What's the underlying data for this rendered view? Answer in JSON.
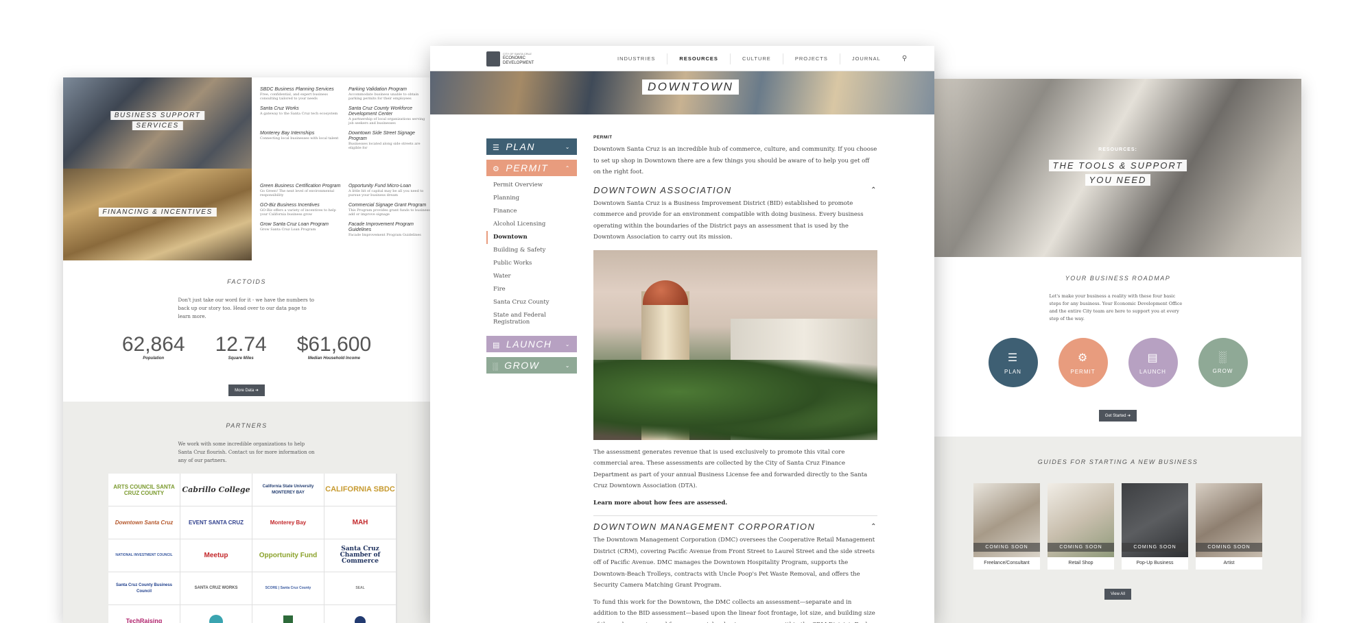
{
  "left": {
    "tile1_label_line1": "BUSINESS SUPPORT",
    "tile1_label_line2": "SERVICES",
    "tile2_label": "FINANCING & INCENTIVES",
    "links_group1": [
      {
        "title": "SBDC Business Planning Services",
        "desc": "Free, confidential, and expert business consulting tailored to your needs"
      },
      {
        "title": "Parking Validation Program",
        "desc": "Accommodate business unable to obtain parking permits for their employees"
      },
      {
        "title": "Santa Cruz Works",
        "desc": "A gateway to the Santa Cruz tech ecosystem"
      },
      {
        "title": "Santa Cruz County Workforce Development Center",
        "desc": "A partnership of local organizations serving job seekers and businesses"
      },
      {
        "title": "Monterey Bay Internships",
        "desc": "Connecting local businesses with local talent"
      },
      {
        "title": "Downtown Side Street Signage Program",
        "desc": "Businesses located along side streets are eligible for"
      }
    ],
    "links_group2": [
      {
        "title": "Green Business Certification Program",
        "desc": "Go Green! The next level of environmental responsibility"
      },
      {
        "title": "Opportunity Fund Micro-Loan",
        "desc": "A little bit of capital may be all you need to pursue your business dream"
      },
      {
        "title": "GO-Biz Business Incentives",
        "desc": "GO-Biz offers a variety of incentives to help your California business grow"
      },
      {
        "title": "Commercial Signage Grant Program",
        "desc": "This Program provides grant funds to business add or improve signage"
      },
      {
        "title": "Grow Santa Cruz Loan Program",
        "desc": "Grow Santa Cruz Loan Program"
      },
      {
        "title": "Facade Improvement Program Guidelines",
        "desc": "Facade Improvement Program Guidelines"
      }
    ],
    "factoids": {
      "title": "FACTOIDS",
      "desc": "Don't just take our word for it - we have the numbers to back up our story too. Head over to our data page to learn more.",
      "stats": [
        {
          "value": "62,864",
          "label": "Population"
        },
        {
          "value": "12.74",
          "label": "Square Miles"
        },
        {
          "value": "$61,600",
          "label": "Median Household Income"
        }
      ],
      "button": "More Data"
    },
    "partners": {
      "title": "PARTNERS",
      "desc": "We work with some incredible organizations to help Santa Cruz flourish. Contact us for more information on any of our partners.",
      "logos": [
        "ARTS COUNCIL SANTA CRUZ COUNTY",
        "Cabrillo College",
        "California State University MONTEREY BAY",
        "CALIFORNIA SBDC",
        "Downtown Santa Cruz",
        "EVENT SANTA CRUZ",
        "Monterey Bay",
        "MAH",
        "NATIONAL INVESTMENT COUNCIL",
        "Meetup",
        "Opportunity Fund",
        "Santa Cruz Chamber of Commerce",
        "Santa Cruz County Business Council",
        "SANTA CRUZ WORKS",
        "SCORE | Santa Cruz County",
        "SEAL",
        "TechRaising",
        "",
        "",
        ""
      ]
    }
  },
  "center": {
    "logo_small": "CITY OF SANTA CRUZ",
    "logo_line1": "ECONOMIC",
    "logo_line2": "DEVELOPMENT",
    "nav": [
      "INDUSTRIES",
      "RESOURCES",
      "CULTURE",
      "PROJECTS",
      "JOURNAL"
    ],
    "hero_title": "DOWNTOWN",
    "side_nav": {
      "plan": "PLAN",
      "permit": "PERMIT",
      "launch": "LAUNCH",
      "grow": "GROW",
      "permit_items": [
        "Permit Overview",
        "Planning",
        "Finance",
        "Alcohol Licensing",
        "Downtown",
        "Building & Safety",
        "Public Works",
        "Water",
        "Fire",
        "Santa Cruz County",
        "State and Federal Registration"
      ]
    },
    "content": {
      "kicker": "PERMIT",
      "intro": "Downtown Santa Cruz is an incredible hub of commerce, culture, and community. If you choose to set up shop in Downtown there are a few things you should be aware of to help you get off on the right foot.",
      "h2_assoc": "DOWNTOWN ASSOCIATION",
      "assoc_p": "Downtown Santa Cruz is a Business Improvement District (BID) established to promote commerce and provide for an environment compatible with doing business. Every business operating within the boundaries of the District pays an assessment that is used by the Downtown Association to carry out its mission.",
      "assoc_p2": "The assessment generates revenue that is used exclusively to promote this vital core commercial area. These assessments are collected by the City of Santa Cruz Finance Department as part of your annual Business License fee and forwarded directly to the Santa Cruz Downtown Association (DTA).",
      "learn_more": "Learn more about how fees are assessed.",
      "h2_dmc": "DOWNTOWN MANAGEMENT CORPORATION",
      "dmc_p": "The Downtown Management Corporation (DMC) oversees the Cooperative Retail Management District (CRM), covering Pacific Avenue from Front Street to Laurel Street and the side streets off of Pacific Avenue. DMC manages the Downtown Hospitality Program, supports the Downtown-Beach Trolleys, contracts with Uncle Poop's Pet Waste Removal, and offers the Security Camera Matching Grant Program.",
      "dmc_p2": "To fund this work for the Downtown, the DMC collects an assessment—separate and in addition to the BID assessment—based upon the linear foot frontage, lot size, and building size of the real property used for commercial or business purposes within the CRM District. Each parcel's assessment is calculated as following a three-part formula:"
    }
  },
  "right": {
    "kicker": "RESOURCES:",
    "hero_line1": "THE TOOLS & SUPPORT",
    "hero_line2": "YOU NEED",
    "roadmap": {
      "title": "YOUR BUSINESS ROADMAP",
      "desc": "Let's make your business a reality with these four basic steps for any business. Your Economic Development Office and the entire City team are here to support you at every step of the way.",
      "steps": [
        "PLAN",
        "PERMIT",
        "LAUNCH",
        "GROW"
      ],
      "button": "Get Started"
    },
    "guides": {
      "title": "GUIDES FOR STARTING A NEW BUSINESS",
      "coming_soon": "COMING SOON",
      "items": [
        "Freelance/Consultant",
        "Retail Shop",
        "Pop-Up Business",
        "Artist"
      ],
      "button": "View All"
    }
  },
  "colors": {
    "plan": "#3e5f73",
    "permit": "#e89c7e",
    "launch": "#b7a1c2",
    "grow": "#8fa996",
    "dark": "#4e545c"
  }
}
